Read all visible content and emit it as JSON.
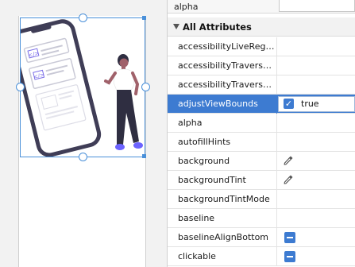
{
  "panel": {
    "top_label": "alpha",
    "section_title": "All Attributes",
    "rows": [
      {
        "name": "accessibilityLiveRegion"
      },
      {
        "name": "accessibilityTraversalA..."
      },
      {
        "name": "accessibilityTraversalB..."
      },
      {
        "name": "adjustViewBounds",
        "value": "true"
      },
      {
        "name": "alpha"
      },
      {
        "name": "autofillHints"
      },
      {
        "name": "background"
      },
      {
        "name": "backgroundTint"
      },
      {
        "name": "backgroundTintMode"
      },
      {
        "name": "baseline"
      },
      {
        "name": "baselineAlignBottom"
      },
      {
        "name": "clickable"
      }
    ]
  },
  "colors": {
    "accent": "#3d7bd1",
    "selection": "#4a90d9"
  },
  "icons": {
    "section_toggle": "triangle-down-icon",
    "color_picker": "eyedropper-icon",
    "checkbox": "checkmark-icon",
    "unset": "minus-icon"
  }
}
